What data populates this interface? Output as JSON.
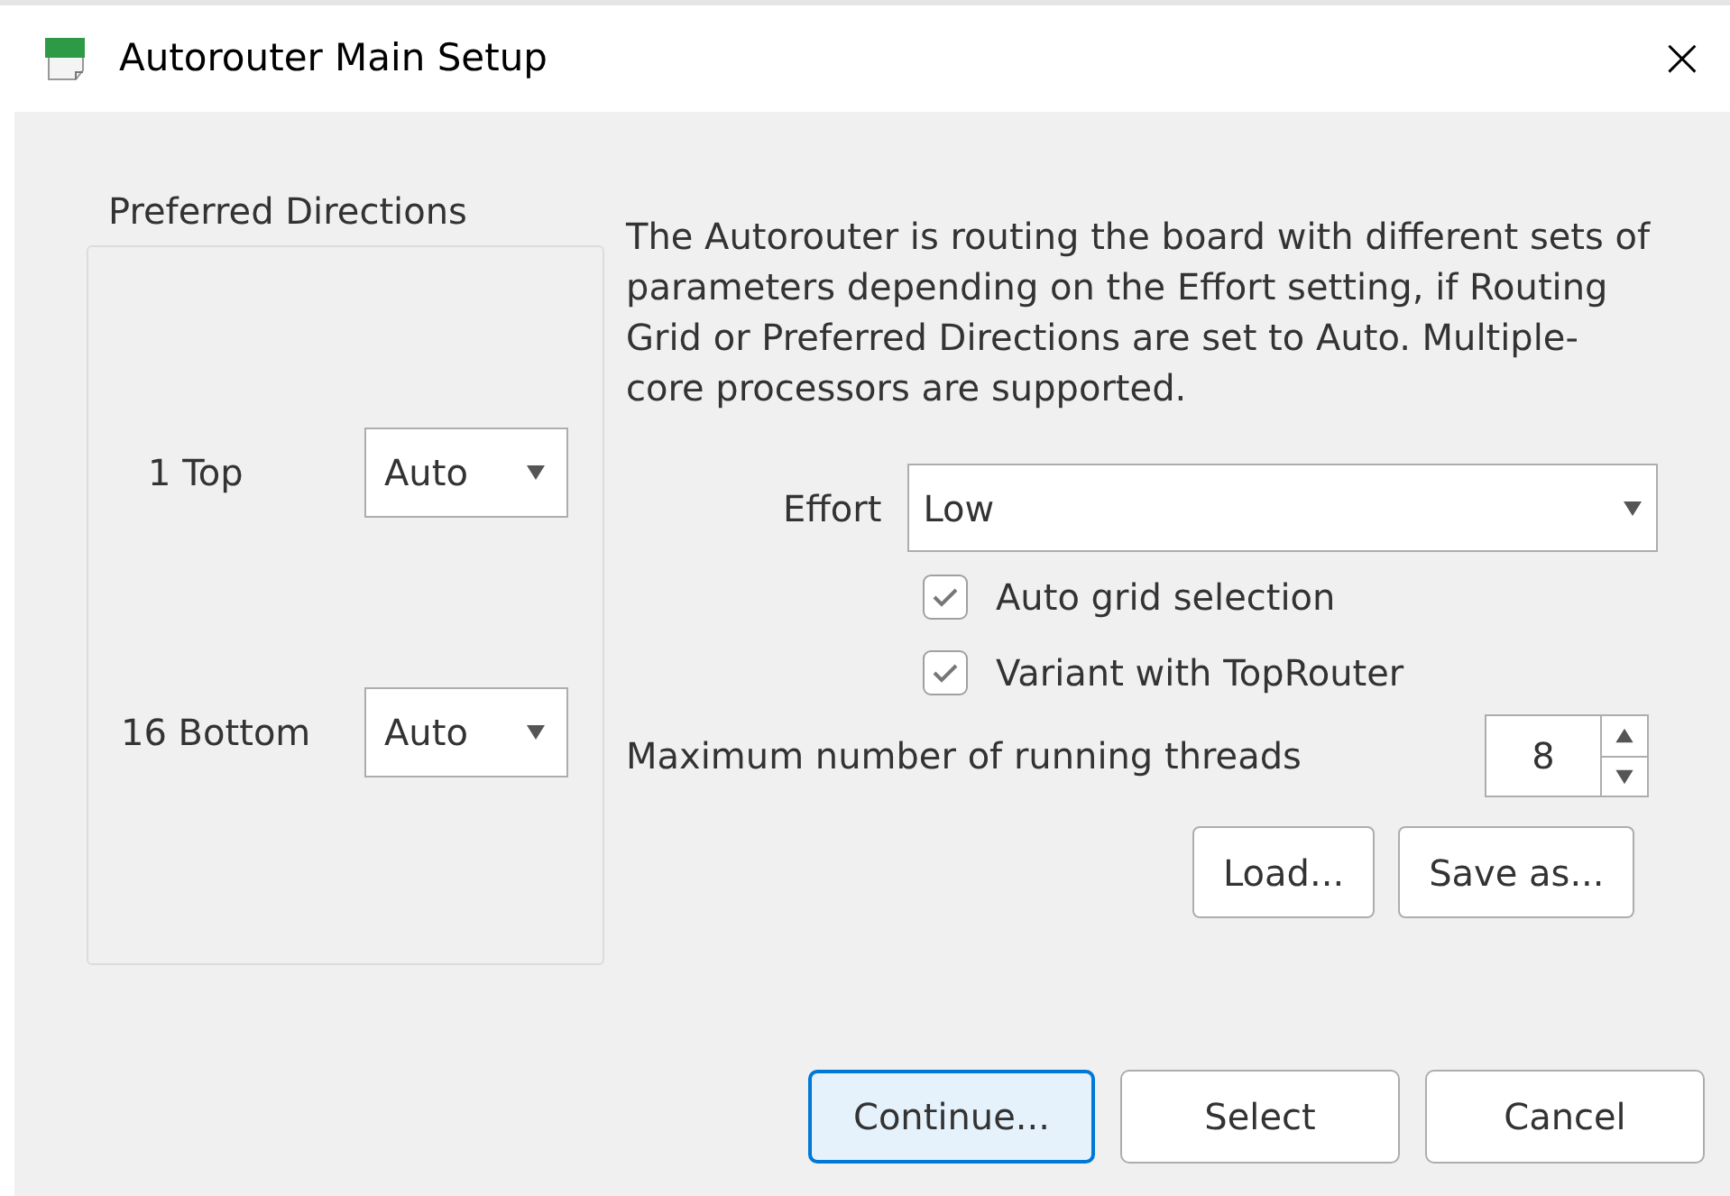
{
  "window": {
    "title": "Autorouter Main Setup",
    "close": "×"
  },
  "preferred_directions": {
    "title": "Preferred Directions",
    "layers": [
      {
        "label": "1 Top",
        "value": "Auto"
      },
      {
        "label": "16 Bottom",
        "value": "Auto"
      }
    ]
  },
  "description": "The Autorouter is routing the board with different sets of parameters depending on the Effort setting, if Routing Grid or Preferred Directions are set to Auto. Multiple-core processors are supported.",
  "effort": {
    "label": "Effort",
    "value": "Low"
  },
  "options": [
    {
      "label": "Auto grid selection",
      "checked": true
    },
    {
      "label": "Variant with TopRouter",
      "checked": true
    }
  ],
  "threads": {
    "label": "Maximum number of running threads",
    "value": "8"
  },
  "file_buttons": [
    "Load...",
    "Save as..."
  ],
  "buttons": [
    {
      "label": "Continue...",
      "default": true
    },
    {
      "label": "Select",
      "default": false
    },
    {
      "label": "Cancel",
      "default": false
    }
  ]
}
